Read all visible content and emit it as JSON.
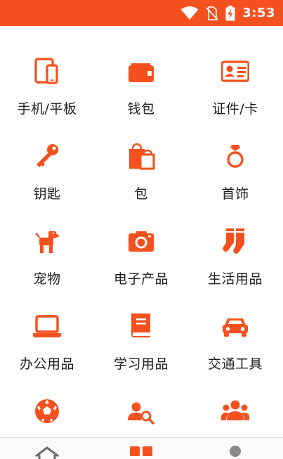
{
  "status_bar": {
    "time": "3:53",
    "icons": [
      "wifi-icon",
      "no-sim-icon",
      "battery-charging-icon"
    ],
    "background": "#f4511e"
  },
  "accent_color": "#f4511e",
  "categories": [
    {
      "label": "手机/平板",
      "icon": "phone-tablet-icon"
    },
    {
      "label": "钱包",
      "icon": "wallet-icon"
    },
    {
      "label": "证件/卡",
      "icon": "id-card-icon"
    },
    {
      "label": "钥匙",
      "icon": "key-icon"
    },
    {
      "label": "包",
      "icon": "shopping-bag-icon"
    },
    {
      "label": "首饰",
      "icon": "ring-icon"
    },
    {
      "label": "宠物",
      "icon": "dog-icon"
    },
    {
      "label": "电子产品",
      "icon": "camera-icon"
    },
    {
      "label": "生活用品",
      "icon": "socks-icon"
    },
    {
      "label": "办公用品",
      "icon": "laptop-icon"
    },
    {
      "label": "学习用品",
      "icon": "book-icon"
    },
    {
      "label": "交通工具",
      "icon": "car-icon"
    },
    {
      "label": "",
      "icon": "soccer-ball-icon"
    },
    {
      "label": "",
      "icon": "person-search-icon"
    },
    {
      "label": "",
      "icon": "group-icon"
    }
  ],
  "bottom_nav": {
    "items": [
      {
        "icon": "home-icon"
      },
      {
        "icon": "grid-icon",
        "active": true
      },
      {
        "icon": "user-icon"
      }
    ]
  }
}
